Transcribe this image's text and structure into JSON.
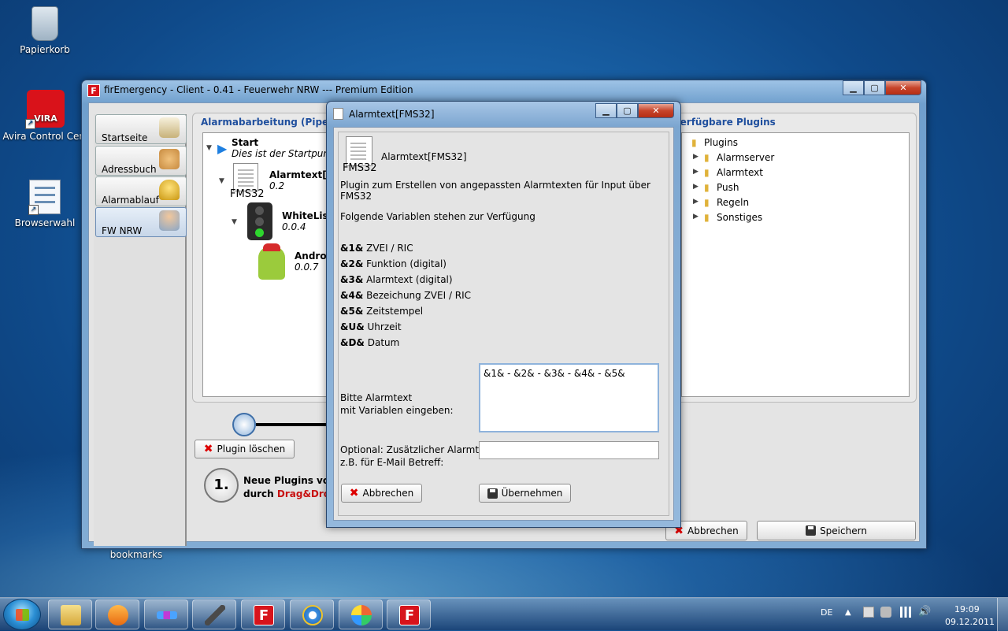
{
  "desktop": {
    "icons": [
      {
        "label": "Papierkorb",
        "icon": "recycle-bin-icon"
      },
      {
        "label": "Avira Control Cent",
        "icon": "avira-icon"
      },
      {
        "label": "Browserwahl",
        "icon": "browser-choice-icon"
      },
      {
        "label": "bookmarks",
        "icon": "bookmarks-icon"
      }
    ],
    "avira_badge": "VIRA"
  },
  "main_window": {
    "title": "firEmergency - Client - 0.41 - Feuerwehr NRW --- Premium Edition",
    "app_icon": "F",
    "sidebar": [
      {
        "label": "Startseite",
        "icon": "house-icon"
      },
      {
        "label": "Adressbuch",
        "icon": "contacts-icon"
      },
      {
        "label": "Alarmablauf",
        "icon": "bell-icon"
      },
      {
        "label": "FW NRW",
        "icon": "user-icon"
      }
    ],
    "pipeline": {
      "title": "Alarmabarbeitung (Pipeline)",
      "nodes": [
        {
          "name": "Start",
          "desc": "Dies ist der Startpunkt"
        },
        {
          "name": "Alarmtext[FM",
          "version": "0.2",
          "badge": "FMS32"
        },
        {
          "name": "WhiteList",
          "version": "0.0.4"
        },
        {
          "name": "Android",
          "version": "0.0.7"
        }
      ]
    },
    "plugins": {
      "title": "Verfügbare Plugins",
      "root": "Plugins",
      "items": [
        "Alarmserver",
        "Alarmtext",
        "Push",
        "Regeln",
        "Sonstiges"
      ]
    },
    "delete_button": "Plugin löschen",
    "hint": {
      "number": "1.",
      "line1": "Neue Plugins vor",
      "line2_prefix": "durch ",
      "line2_highlight": "Drag&Drop"
    },
    "cancel_button": "Abbrechen",
    "save_button": "Speichern"
  },
  "dialog": {
    "title": "Alarmtext[FMS32]",
    "header_name": "Alarmtext[FMS32]",
    "header_badge": "FMS32",
    "description": "Plugin zum Erstellen von angepassten Alarmtexten für Input über FMS32",
    "vars_intro": "Folgende Variablen stehen zur Verfügung",
    "variables": [
      {
        "key": "&1&",
        "desc": "ZVEI / RIC"
      },
      {
        "key": "&2&",
        "desc": "Funktion (digital)"
      },
      {
        "key": "&3&",
        "desc": "Alarmtext (digital)"
      },
      {
        "key": "&4&",
        "desc": "Bezeichung ZVEI / RIC"
      },
      {
        "key": "&5&",
        "desc": "Zeitstempel"
      },
      {
        "key": "&U&",
        "desc": "Uhrzeit"
      },
      {
        "key": "&D&",
        "desc": "Datum"
      }
    ],
    "input_label_1": "Bitte Alarmtext",
    "input_label_2": "mit Variablen eingeben:",
    "alarmtext_value": "&1& - &2& - &3& - &4& - &5&",
    "optional_label_1": "Optional: Zusätzlicher Alarmtext",
    "optional_label_2": "z.B. für E-Mail Betreff:",
    "optional_value": "",
    "cancel_button": "Abbrechen",
    "accept_button": "Übernehmen"
  },
  "taskbar": {
    "apps": [
      {
        "name": "explorer",
        "icon": "folder-icon"
      },
      {
        "name": "media-player",
        "icon": "media-player-icon"
      },
      {
        "name": "app3",
        "icon": "equalizer-icon"
      },
      {
        "name": "app4",
        "icon": "pen-icon"
      },
      {
        "name": "firEmergency",
        "icon": "firemergency-icon",
        "letter": "F"
      },
      {
        "name": "internet-explorer",
        "icon": "ie-icon"
      },
      {
        "name": "paint",
        "icon": "palette-icon"
      },
      {
        "name": "firEmergency-2",
        "icon": "firemergency-icon",
        "letter": "F"
      }
    ],
    "lang": "DE",
    "time": "19:09",
    "date": "09.12.2011"
  }
}
